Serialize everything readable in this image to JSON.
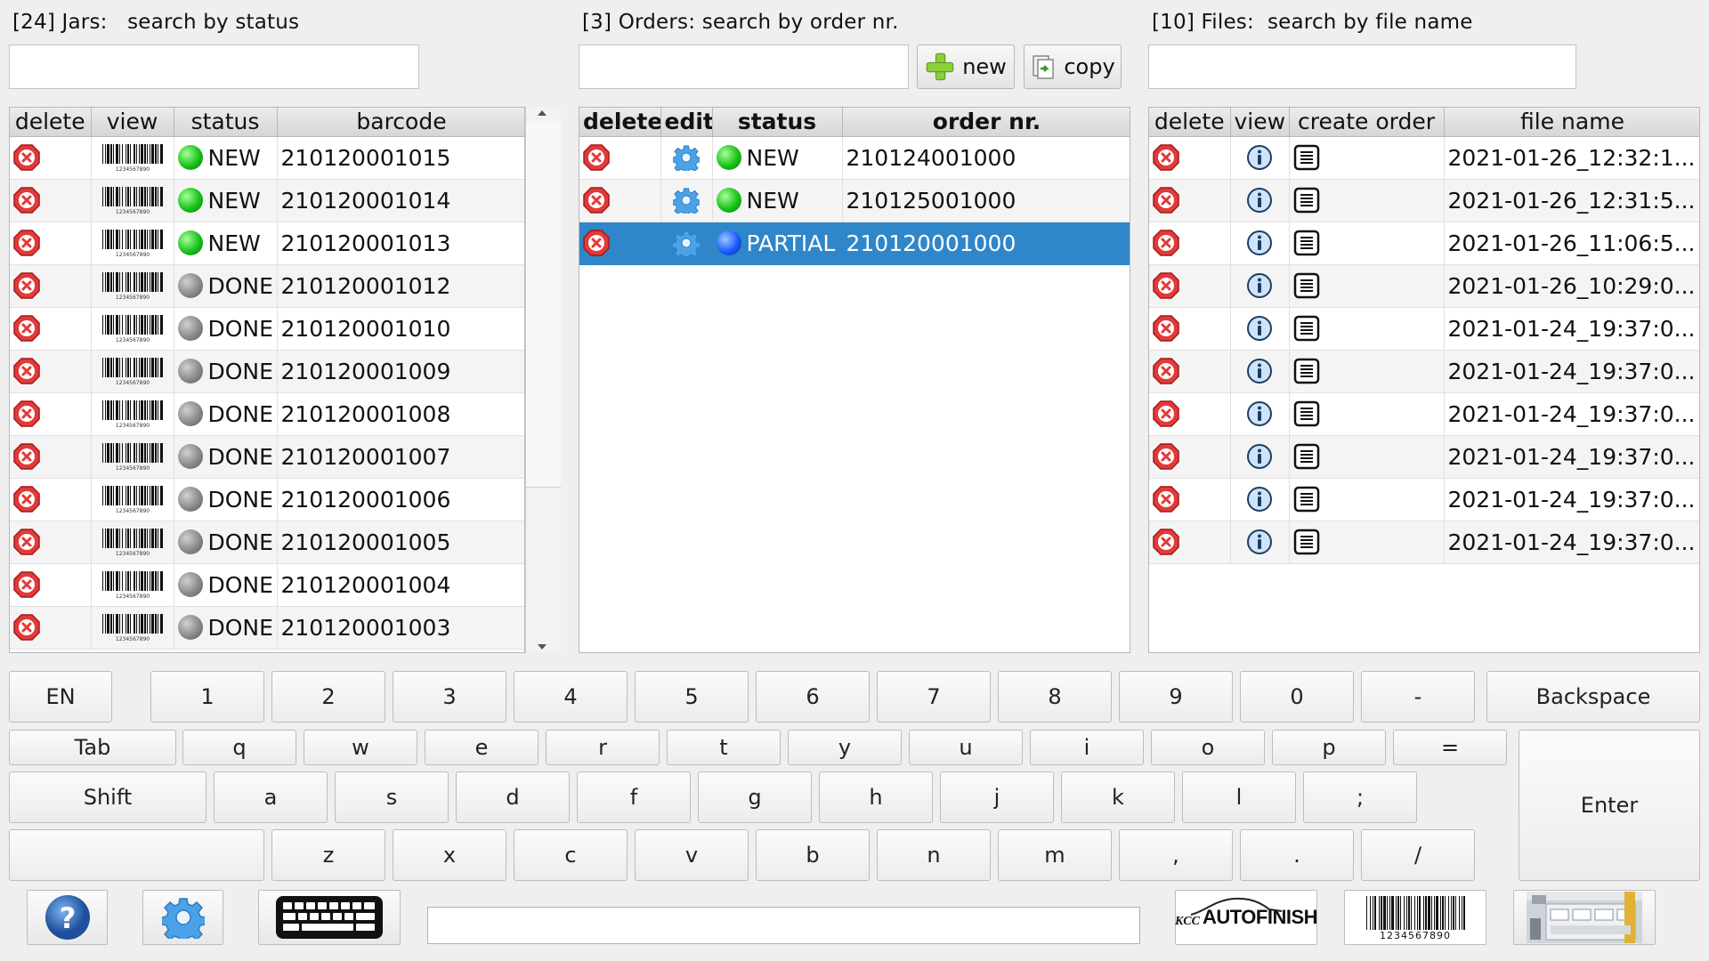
{
  "jars": {
    "title": "[24] Jars:   search by status",
    "search_value": "",
    "columns": [
      "delete",
      "view",
      "status",
      "barcode"
    ],
    "rows": [
      {
        "status": "NEW",
        "status_color": "green",
        "barcode": "210120001015"
      },
      {
        "status": "NEW",
        "status_color": "green",
        "barcode": "210120001014"
      },
      {
        "status": "NEW",
        "status_color": "green",
        "barcode": "210120001013"
      },
      {
        "status": "DONE",
        "status_color": "gray",
        "barcode": "210120001012"
      },
      {
        "status": "DONE",
        "status_color": "gray",
        "barcode": "210120001010"
      },
      {
        "status": "DONE",
        "status_color": "gray",
        "barcode": "210120001009"
      },
      {
        "status": "DONE",
        "status_color": "gray",
        "barcode": "210120001008"
      },
      {
        "status": "DONE",
        "status_color": "gray",
        "barcode": "210120001007"
      },
      {
        "status": "DONE",
        "status_color": "gray",
        "barcode": "210120001006"
      },
      {
        "status": "DONE",
        "status_color": "gray",
        "barcode": "210120001005"
      },
      {
        "status": "DONE",
        "status_color": "gray",
        "barcode": "210120001004"
      },
      {
        "status": "DONE",
        "status_color": "gray",
        "barcode": "210120001003"
      }
    ]
  },
  "orders": {
    "title": "[3] Orders: search by order nr.",
    "search_value": "",
    "new_label": "new",
    "copy_label": "copy",
    "columns": [
      "delete",
      "edit",
      "status",
      "order nr."
    ],
    "rows": [
      {
        "status": "NEW",
        "status_color": "green",
        "order_nr": "210124001000",
        "selected": false
      },
      {
        "status": "NEW",
        "status_color": "green",
        "order_nr": "210125001000",
        "selected": false
      },
      {
        "status": "PARTIAL",
        "status_color": "blue",
        "order_nr": "210120001000",
        "selected": true
      }
    ]
  },
  "files": {
    "title": "[10] Files:  search by file name",
    "search_value": "",
    "columns": [
      "delete",
      "view",
      "create order",
      "file name"
    ],
    "rows": [
      {
        "file_name": "2021-01-26_12:32:1..."
      },
      {
        "file_name": "2021-01-26_12:31:5..."
      },
      {
        "file_name": "2021-01-26_11:06:5..."
      },
      {
        "file_name": "2021-01-26_10:29:0..."
      },
      {
        "file_name": "2021-01-24_19:37:0..."
      },
      {
        "file_name": "2021-01-24_19:37:0..."
      },
      {
        "file_name": "2021-01-24_19:37:0..."
      },
      {
        "file_name": "2021-01-24_19:37:0..."
      },
      {
        "file_name": "2021-01-24_19:37:0..."
      },
      {
        "file_name": "2021-01-24_19:37:0..."
      }
    ]
  },
  "keyboard": {
    "lang": "EN",
    "row1": [
      "1",
      "2",
      "3",
      "4",
      "5",
      "6",
      "7",
      "8",
      "9",
      "0",
      "-"
    ],
    "backspace": "Backspace",
    "tab": "Tab",
    "row2": [
      "q",
      "w",
      "e",
      "r",
      "t",
      "y",
      "u",
      "i",
      "o",
      "p",
      "="
    ],
    "shift": "Shift",
    "row3": [
      "a",
      "s",
      "d",
      "f",
      "g",
      "h",
      "j",
      "k",
      "l",
      ";"
    ],
    "enter": "Enter",
    "row4": [
      "z",
      "x",
      "c",
      "v",
      "b",
      "n",
      "m",
      ",",
      ".",
      "/"
    ]
  },
  "bottom": {
    "input_value": "",
    "brand_prefix": "KCC",
    "brand_name": "AUTOFINISH",
    "barcode_digits": "1234567890",
    "icons": [
      "help-icon",
      "gear-icon",
      "keyboard-icon",
      "barcode-icon",
      "machine-icon"
    ]
  },
  "colors": {
    "selection": "#2f86c8",
    "delete_red": "#e23a3a",
    "gear_blue": "#4aa3e8"
  }
}
